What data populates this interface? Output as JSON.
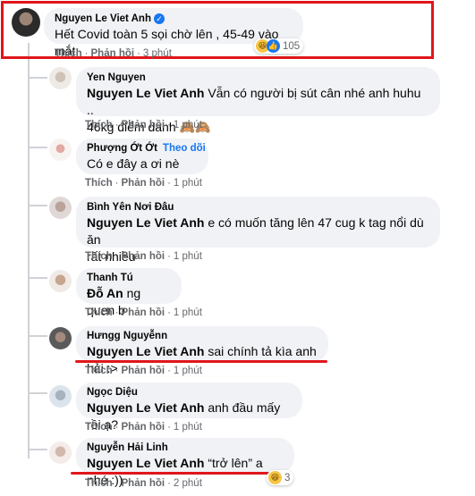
{
  "main_comment": {
    "author": "Nguyen Le Viet Anh",
    "text": "Hết Covid toàn 5 sọi chờ lên , 45-49 vào mắt .",
    "reaction_count": "105",
    "actions": {
      "like": "Thích",
      "reply": "Phản hồi",
      "time": "3 phút"
    }
  },
  "replies": [
    {
      "author": "Yen Nguyen",
      "tag": "Nguyen Le Viet Anh",
      "text_line1": " Vẫn có người bị sút cân nhé anh huhu ..",
      "text_line2": "46kg điểm danh 🙈🙈",
      "actions": {
        "like": "Thích",
        "reply": "Phản hồi",
        "time": "1 phút"
      }
    },
    {
      "author": "Phượng Ớt Ớt",
      "follow": "Theo dõi",
      "text": "Có e đây a ơi nè",
      "actions": {
        "like": "Thích",
        "reply": "Phản hồi",
        "time": "1 phút"
      }
    },
    {
      "author": "Bình Yên Nơi Đâu",
      "tag": "Nguyen Le Viet Anh",
      "text_line1": " e có muốn tăng lên 47 cug k tag nổi dù ăn",
      "text_line2": "rất nhiều",
      "actions": {
        "like": "Thích",
        "reply": "Phản hồi",
        "time": "1 phút"
      }
    },
    {
      "author": "Thanh Tú",
      "tag": "Đỗ An",
      "text": " ng quen b",
      "actions": {
        "like": "Thích",
        "reply": "Phản hồi",
        "time": "1 phút"
      }
    },
    {
      "author": "Hưngg Nguyễnn",
      "tag": "Nguyen Le Viet Anh",
      "text": " sai chính tả kìa anh hải :>",
      "actions": {
        "like": "Thích",
        "reply": "Phản hồi",
        "time": "1 phút"
      }
    },
    {
      "author": "Ngọc Diệu",
      "tag": "Nguyen Le Viet Anh",
      "text": " anh đầu mấy rồi ạ?",
      "actions": {
        "like": "Thích",
        "reply": "Phản hồi",
        "time": "1 phút"
      }
    },
    {
      "author": "Nguyễn Hải Linh",
      "tag": "Nguyen Le Viet Anh",
      "text": " “trở lên” a nhé :))",
      "reaction_count": "3",
      "actions": {
        "like": "Thích",
        "reply": "Phản hồi",
        "time": "2 phút"
      }
    }
  ],
  "colors": {
    "highlight_red": "#e0161b",
    "bubble": "#f0f2f5",
    "meta_gray": "#65676b",
    "link_blue": "#1877f2"
  },
  "icons": {
    "verified": "verified-badge-icon",
    "reactions": [
      "haha-icon",
      "like-icon"
    ]
  }
}
